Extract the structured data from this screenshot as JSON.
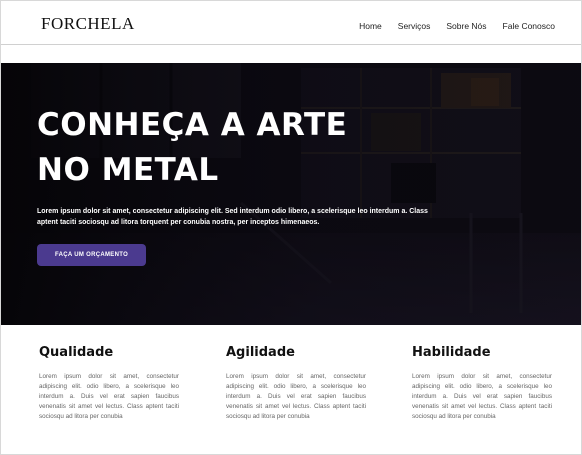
{
  "header": {
    "logo": "FORCHELA",
    "nav": [
      "Home",
      "Serviços",
      "Sobre Nós",
      "Fale Conosco"
    ]
  },
  "hero": {
    "title_line1": "CONHEÇA A ARTE",
    "title_line2": "NO METAL",
    "description": "Lorem ipsum dolor sit amet, consectetur adipiscing elit. Sed interdum odio libero, a scelerisque leo interdum a. Class aptent taciti sociosqu ad litora torquent per conubia nostra, per inceptos himenaeos.",
    "cta_label": "FAÇA UM ORÇAMENTO"
  },
  "features": [
    {
      "title": "Qualidade",
      "text": "Lorem ipsum dolor sit amet, consectetur adipiscing elit. odio libero, a scelerisque leo interdum a. Duis vel erat sapien faucibus venenatis sit amet vel lectus. Class aptent taciti sociosqu ad litora per conubia"
    },
    {
      "title": "Agilidade",
      "text": "Lorem ipsum dolor sit amet, consectetur adipiscing elit. odio libero, a scelerisque leo interdum a. Duis vel erat sapien faucibus venenatis sit amet vel lectus. Class aptent taciti sociosqu ad litora per conubia"
    },
    {
      "title": "Habilidade",
      "text": "Lorem ipsum dolor sit amet, consectetur adipiscing elit. odio libero, a scelerisque leo interdum a. Duis vel erat sapien faucibus venenatis sit amet vel lectus. Class aptent taciti sociosqu ad litora per conubia"
    }
  ],
  "colors": {
    "accent": "#4b3a8f",
    "hero_bg": "#0c0a10"
  }
}
